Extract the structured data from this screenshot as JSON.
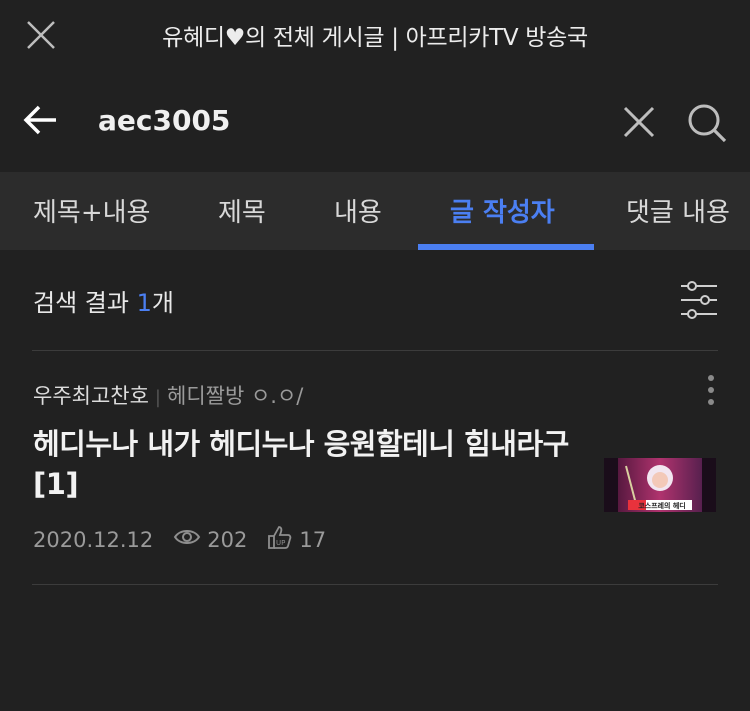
{
  "header": {
    "title": "유혜디♥의 전체 게시글 | 아프리카TV 방송국"
  },
  "search": {
    "value": "aec3005"
  },
  "tabs": [
    {
      "label": "제목+내용"
    },
    {
      "label": "제목"
    },
    {
      "label": "내용"
    },
    {
      "label": "글 작성자"
    },
    {
      "label": "댓글 내용"
    }
  ],
  "results": {
    "prefix": "검색 결과 ",
    "count": "1",
    "suffix": "개"
  },
  "post": {
    "author": "우주최고찬호",
    "separator": "|",
    "board": "헤디짤방 ㅇ.ㅇ/",
    "title": "헤디누나 내가 헤디누나 응원할테니 힘내라구 [1]",
    "date": "2020.12.12",
    "views": "202",
    "likes": "17",
    "thumbnail_caption": "코스프레의 헤디"
  },
  "colors": {
    "background": "#212121",
    "tabs_background": "#2c2c2c",
    "accent": "#4b7ff2"
  }
}
